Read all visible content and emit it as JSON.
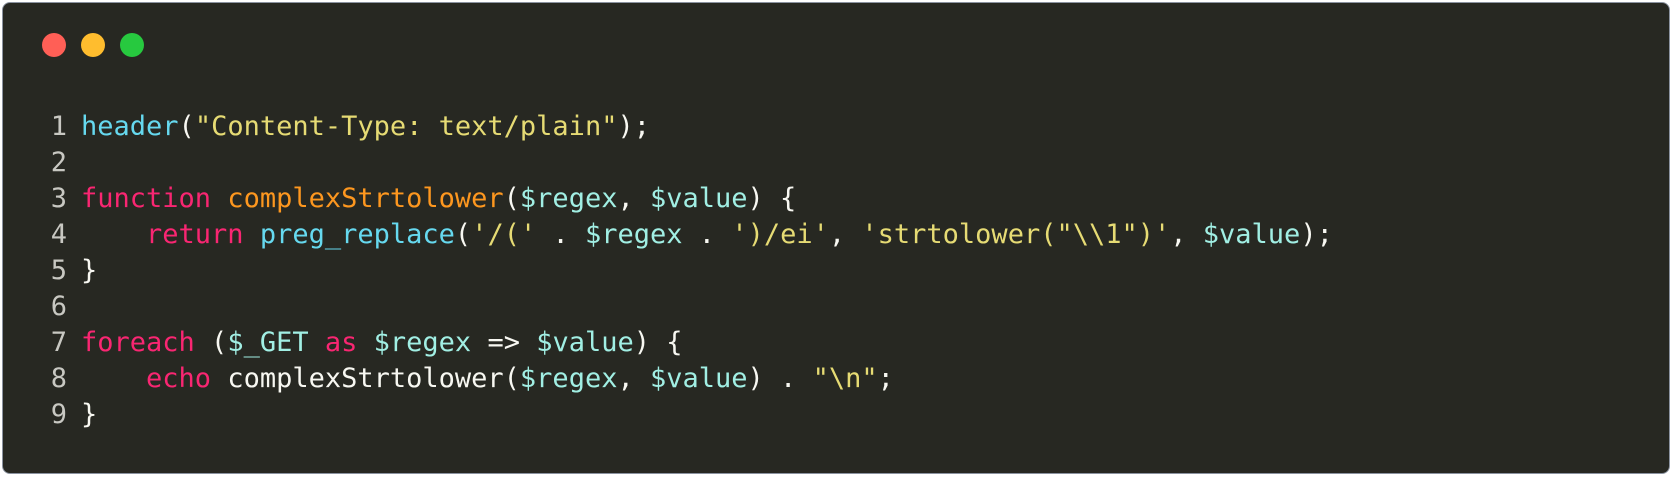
{
  "window": {
    "controls": [
      {
        "name": "close",
        "color": "#ff5f56"
      },
      {
        "name": "minimize",
        "color": "#ffbd2e"
      },
      {
        "name": "maximize",
        "color": "#27c93f"
      }
    ]
  },
  "code": {
    "language": "php",
    "lines": [
      {
        "number": "1",
        "tokens": [
          {
            "t": "header",
            "k": "fn"
          },
          {
            "t": "(",
            "k": "pl"
          },
          {
            "t": "\"Content-Type: text/plain\"",
            "k": "str"
          },
          {
            "t": ");",
            "k": "pl"
          }
        ]
      },
      {
        "number": "2",
        "tokens": []
      },
      {
        "number": "3",
        "tokens": [
          {
            "t": "function",
            "k": "kw"
          },
          {
            "t": " ",
            "k": "pl"
          },
          {
            "t": "complexStrtolower",
            "k": "def"
          },
          {
            "t": "(",
            "k": "pl"
          },
          {
            "t": "$regex",
            "k": "var"
          },
          {
            "t": ", ",
            "k": "pl"
          },
          {
            "t": "$value",
            "k": "var"
          },
          {
            "t": ") {",
            "k": "pl"
          }
        ]
      },
      {
        "number": "4",
        "tokens": [
          {
            "t": "    ",
            "k": "pl"
          },
          {
            "t": "return",
            "k": "kw"
          },
          {
            "t": " ",
            "k": "pl"
          },
          {
            "t": "preg_replace",
            "k": "fn"
          },
          {
            "t": "(",
            "k": "pl"
          },
          {
            "t": "'/('",
            "k": "str"
          },
          {
            "t": " . ",
            "k": "pl"
          },
          {
            "t": "$regex",
            "k": "var"
          },
          {
            "t": " . ",
            "k": "pl"
          },
          {
            "t": "')/ei'",
            "k": "str"
          },
          {
            "t": ", ",
            "k": "pl"
          },
          {
            "t": "'strtolower(\"\\\\1\")'",
            "k": "str"
          },
          {
            "t": ", ",
            "k": "pl"
          },
          {
            "t": "$value",
            "k": "var"
          },
          {
            "t": ");",
            "k": "pl"
          }
        ]
      },
      {
        "number": "5",
        "tokens": [
          {
            "t": "}",
            "k": "pl"
          }
        ]
      },
      {
        "number": "6",
        "tokens": []
      },
      {
        "number": "7",
        "tokens": [
          {
            "t": "foreach",
            "k": "kw"
          },
          {
            "t": " (",
            "k": "pl"
          },
          {
            "t": "$_GET",
            "k": "var"
          },
          {
            "t": " ",
            "k": "pl"
          },
          {
            "t": "as",
            "k": "kw"
          },
          {
            "t": " ",
            "k": "pl"
          },
          {
            "t": "$regex",
            "k": "var"
          },
          {
            "t": " => ",
            "k": "pl"
          },
          {
            "t": "$value",
            "k": "var"
          },
          {
            "t": ") {",
            "k": "pl"
          }
        ]
      },
      {
        "number": "8",
        "tokens": [
          {
            "t": "    ",
            "k": "pl"
          },
          {
            "t": "echo",
            "k": "kw"
          },
          {
            "t": " complexStrtolower(",
            "k": "pl"
          },
          {
            "t": "$regex",
            "k": "var"
          },
          {
            "t": ", ",
            "k": "pl"
          },
          {
            "t": "$value",
            "k": "var"
          },
          {
            "t": ") . ",
            "k": "pl"
          },
          {
            "t": "\"\\n\"",
            "k": "str"
          },
          {
            "t": ";",
            "k": "pl"
          }
        ]
      },
      {
        "number": "9",
        "tokens": [
          {
            "t": "}",
            "k": "pl"
          }
        ]
      }
    ]
  }
}
